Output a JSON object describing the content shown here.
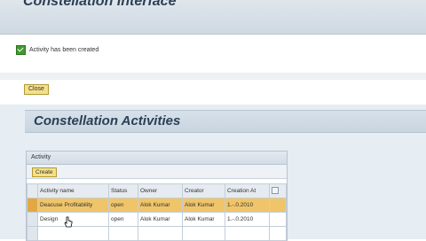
{
  "app": {
    "title": "Constellation Interface"
  },
  "message": {
    "text": "Activity has been created",
    "icon": "check-icon",
    "color": "#3f9b2f"
  },
  "buttons": {
    "close_label": "Close",
    "create_label": "Create"
  },
  "activities": {
    "section_title": "Constellation Activities",
    "panel_title": "Activity",
    "columns": [
      "Activity name",
      "Status",
      "Owner",
      "Creator",
      "Creation At"
    ],
    "rows": [
      {
        "name": "Deacuse Profitability",
        "status": "open",
        "owner": "Alok Kumar",
        "creator": "Alok Kumar",
        "created": "1.-.0.2010",
        "selected": true
      },
      {
        "name": "Design",
        "status": "open",
        "owner": "Alok Kumar",
        "creator": "Alok Kumar",
        "created": "1.-.0.2010",
        "selected": false
      },
      {
        "name": "",
        "status": "",
        "owner": "",
        "creator": "",
        "created": "",
        "selected": false
      }
    ]
  },
  "colors": {
    "selection": "#f0c56a",
    "button": "#f5e08a",
    "header": "#2b3f55"
  }
}
